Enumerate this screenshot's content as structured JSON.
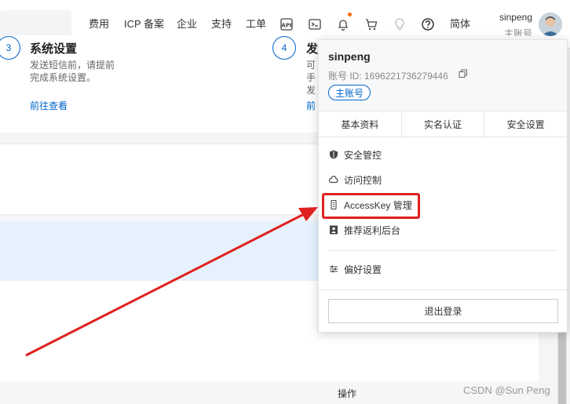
{
  "topnav": {
    "items": [
      "费用",
      "ICP 备案",
      "企业",
      "支持",
      "工单"
    ],
    "lang": "简体",
    "user_name": "sinpeng",
    "user_role": "主账号"
  },
  "steps": [
    {
      "num": "3",
      "title": "系统设置",
      "desc1": "发送短信前，请提前",
      "desc2": "完成系统设置。",
      "link": "前往查看"
    },
    {
      "num": "4",
      "title": "发",
      "desc1": "可",
      "desc2": "手",
      "desc3": "发",
      "link": "前"
    }
  ],
  "table": {
    "ops_header": "操作"
  },
  "dropdown": {
    "name": "sinpeng",
    "account_id_label": "账号 ID: 1696221736279446",
    "role": "主账号",
    "tabs": [
      "基本资料",
      "实名认证",
      "安全设置"
    ],
    "items": {
      "security_control": "安全管控",
      "access_control": "访问控制",
      "accesskey": "AccessKey 管理",
      "rebate": "推荐返利后台",
      "preferences": "偏好设置"
    },
    "logout": "退出登录"
  },
  "watermark": "CSDN @Sun  Peng",
  "colors": {
    "accent": "#0064c8",
    "annotation": "#e02020",
    "highlight": "#e5f2fd"
  }
}
